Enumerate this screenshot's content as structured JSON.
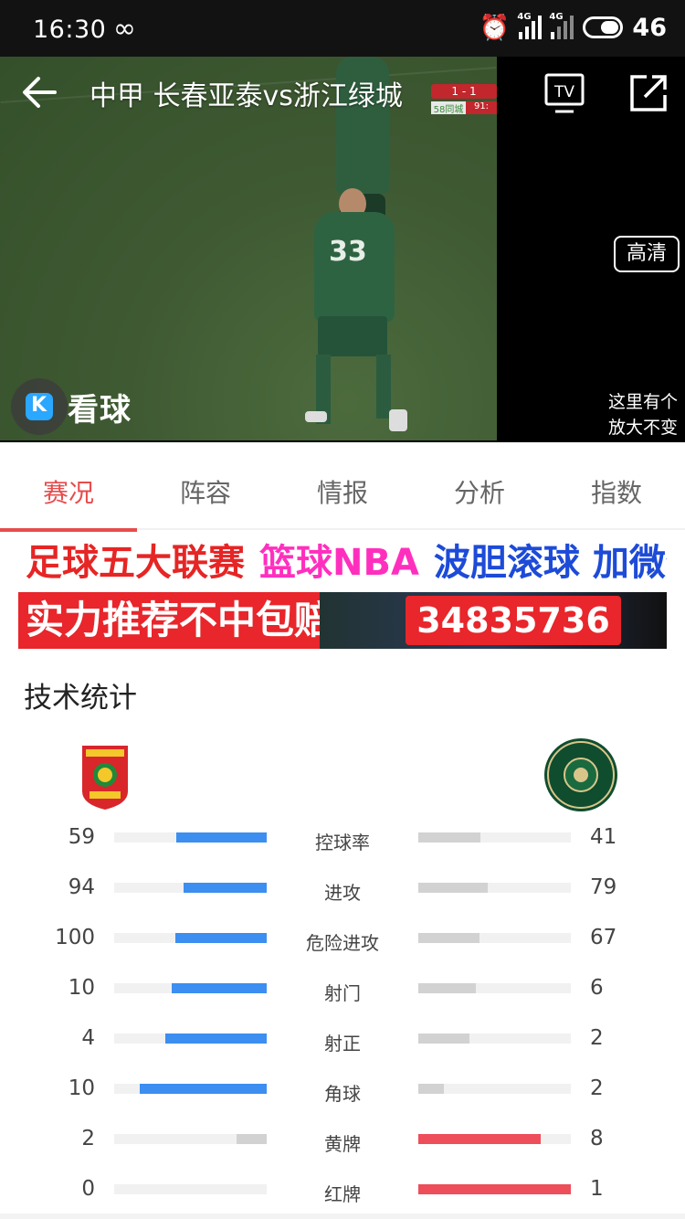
{
  "status_bar": {
    "time": "16:30",
    "infinity": "∞",
    "alarm": "⏰",
    "net1": "4G",
    "net2": "4G",
    "battery": "46"
  },
  "video": {
    "title": "中甲 长春亚泰vs浙江绿城",
    "tv_label": "TV",
    "hd_label": "高清",
    "corner_note_line1": "这里有个",
    "corner_note_line2": "放大不变",
    "logo_k": "K",
    "logo_text": "看球",
    "score_text": "1 - 1",
    "jersey_number": "33",
    "scorebug_left": "58同城",
    "scorebug_right": "91:"
  },
  "tabs": [
    {
      "label": "赛况",
      "active": true
    },
    {
      "label": "阵容",
      "active": false
    },
    {
      "label": "情报",
      "active": false
    },
    {
      "label": "分析",
      "active": false
    },
    {
      "label": "指数",
      "active": false
    }
  ],
  "ad": {
    "part1": "足球五大联赛",
    "part2": "篮球NBA",
    "part3": "波胆滚球 加微信",
    "part4": "实力推荐不中包赔",
    "part5": "34835736"
  },
  "stats": {
    "title": "技术统计",
    "home_color": "#3c8ef0",
    "away_color": "#ee4d5a",
    "rows": [
      {
        "label": "控球率",
        "home": "59",
        "away": "41",
        "home_val": 59,
        "away_val": 41,
        "highlight": "home"
      },
      {
        "label": "进攻",
        "home": "94",
        "away": "79",
        "home_val": 94,
        "away_val": 79,
        "highlight": "home"
      },
      {
        "label": "危险进攻",
        "home": "100",
        "away": "67",
        "home_val": 100,
        "away_val": 67,
        "highlight": "home"
      },
      {
        "label": "射门",
        "home": "10",
        "away": "6",
        "home_val": 10,
        "away_val": 6,
        "highlight": "home"
      },
      {
        "label": "射正",
        "home": "4",
        "away": "2",
        "home_val": 4,
        "away_val": 2,
        "highlight": "home"
      },
      {
        "label": "角球",
        "home": "10",
        "away": "2",
        "home_val": 10,
        "away_val": 2,
        "highlight": "home"
      },
      {
        "label": "黄牌",
        "home": "2",
        "away": "8",
        "home_val": 2,
        "away_val": 8,
        "highlight": "away"
      },
      {
        "label": "红牌",
        "home": "0",
        "away": "1",
        "home_val": 0,
        "away_val": 1,
        "highlight": "away"
      }
    ]
  }
}
